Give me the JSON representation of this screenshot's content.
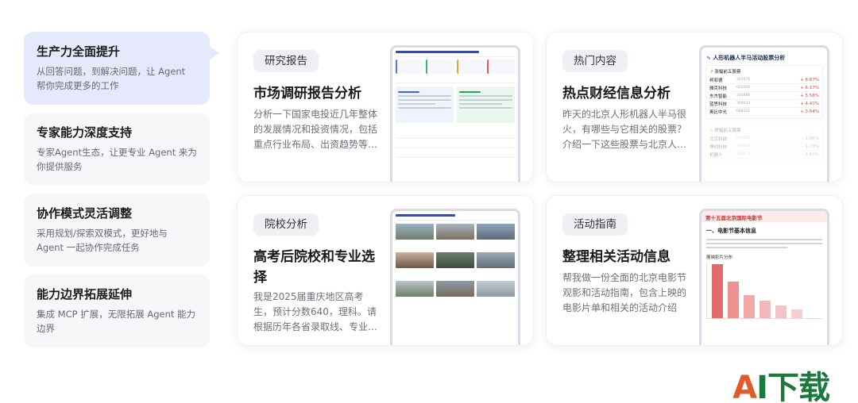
{
  "features": [
    {
      "title": "生产力全面提升",
      "desc": "从回答问题，到解决问题，让 Agent 帮你完成更多的工作"
    },
    {
      "title": "专家能力深度支持",
      "desc": "专家Agent生态，让更专业 Agent 来为你提供服务"
    },
    {
      "title": "协作模式灵活调整",
      "desc": "采用规划/探索双模式，更好地与 Agent 一起协作完成任务"
    },
    {
      "title": "能力边界拓展延伸",
      "desc": "集成 MCP 扩展，无限拓展 Agent 能力边界"
    }
  ],
  "cards": [
    {
      "tag": "研究报告",
      "title": "市场调研报告分析",
      "desc": "分析一下国家电投近几年整体的发展情况和投资情况，包括重点行业布局、出资趋势等…"
    },
    {
      "tag": "热门内容",
      "title": "热点财经信息分析",
      "desc": "昨天的北京人形机器人半马很火，有哪些与它相关的股票？介绍一下这些股票与北京人…"
    },
    {
      "tag": "院校分析",
      "title": "高考后院校和专业选择",
      "desc": "我是2025届重庆地区高考生，预计分数640，理科。请根据历年各省录取线、专业热度…"
    },
    {
      "tag": "活动指南",
      "title": "整理相关活动信息",
      "desc": "帮我做一份全面的北京电影节观影和活动指南，包含上映的电影片单和相关的活动介绍"
    }
  ],
  "stock": {
    "title": "人形机器人半马活动股票分析",
    "up_head": "涨幅前五股票",
    "down_head": "跌幅前五股票",
    "up": [
      {
        "name": "柯菲德",
        "code": "301076",
        "change": "+ 8.87%"
      },
      {
        "name": "雅克科技",
        "code": "002409",
        "change": "+ 6.17%"
      },
      {
        "name": "东杰智能",
        "code": "300486",
        "change": "+ 5.58%"
      },
      {
        "name": "蓝思科技",
        "code": "300433",
        "change": "+ 4.41%"
      },
      {
        "name": "奥比中光",
        "code": "688322",
        "change": "+ 3.64%"
      }
    ],
    "down": [
      {
        "name": "北京科锐",
        "code": "002350",
        "change": "- 1.96%"
      },
      {
        "name": "博创科技",
        "code": "300548",
        "change": "- 1.73%"
      },
      {
        "name": "机器人",
        "code": "300024",
        "change": "- 1.60%"
      }
    ]
  },
  "film": {
    "header": "第十五届北京国际电影节",
    "section": "一、电影节基本信息",
    "chart_label": "展映影片分布"
  },
  "logo": {
    "a": "A",
    "rest": "I下载"
  }
}
